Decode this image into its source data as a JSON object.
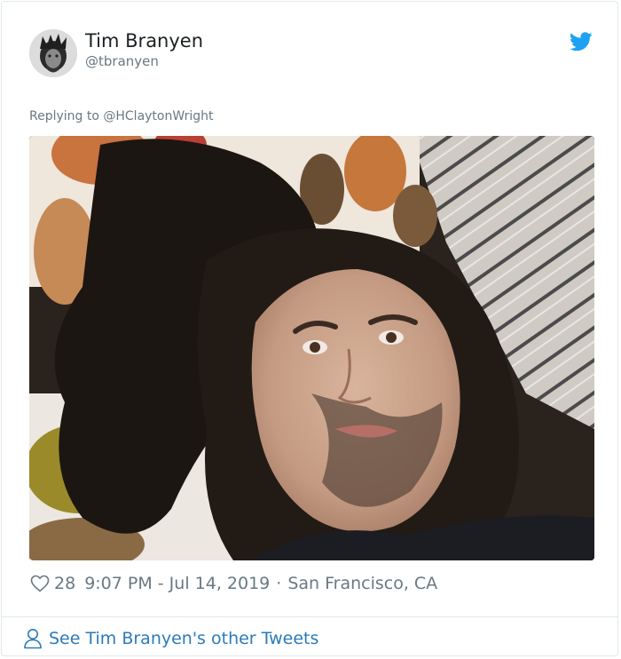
{
  "tweet": {
    "author": {
      "display_name": "Tim Branyen",
      "handle": "@tbranyen",
      "avatar_icon": "avatar"
    },
    "reply_to": "Replying to @HClaytonWright",
    "photo": {
      "subject": "selfie-photo"
    },
    "likes": "28",
    "timestamp": "9:07 PM - Jul 14, 2019",
    "separator": "·",
    "location": "San Francisco, CA"
  },
  "footer": {
    "link_text": "See Tim Branyen's other Tweets"
  },
  "icons": {
    "brand": "twitter-bird-icon",
    "like": "heart-icon",
    "profile": "user-icon"
  },
  "colors": {
    "brand_blue": "#1da1f2",
    "link_blue": "#2b7bb9",
    "secondary_text": "#697882",
    "border": "#e1e8ed"
  }
}
